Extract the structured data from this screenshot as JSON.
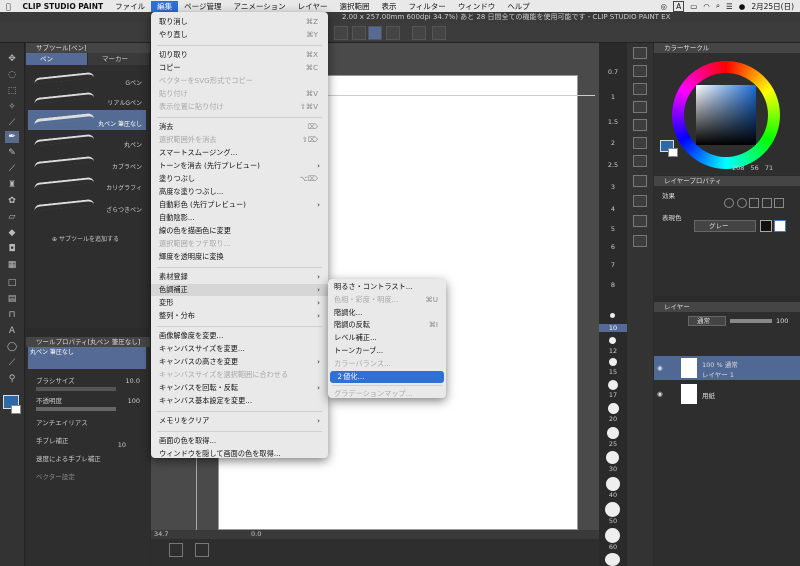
{
  "menubar": {
    "app_name": "CLIP STUDIO PAINT",
    "items": [
      "ファイル",
      "編集",
      "ページ管理",
      "アニメーション",
      "レイヤー",
      "選択範囲",
      "表示",
      "フィルター",
      "ウィンドウ",
      "ヘルプ"
    ],
    "active_item": "編集",
    "status_a": "A",
    "date": "2月25日(日)"
  },
  "titlebar": {
    "text": "2.00 x 257.00mm 600dpi 34.7%) あと 28 日間全ての機能を使用可能です - CLIP STUDIO PAINT EX"
  },
  "subtool_panel": {
    "title": "サブツール[ペン]",
    "tabs": [
      "ペン",
      "マーカー"
    ],
    "brushes": [
      {
        "label": "Gペン",
        "selected": false
      },
      {
        "label": "リアルGペン",
        "selected": false
      },
      {
        "label": "丸ペン 筆圧なし",
        "selected": true
      },
      {
        "label": "丸ペン",
        "selected": false
      },
      {
        "label": "カブラペン",
        "selected": false
      },
      {
        "label": "カリグラフィ",
        "selected": false
      },
      {
        "label": "ざらつきペン",
        "selected": false
      }
    ],
    "add_label": "サブツールを追加する"
  },
  "tool_property": {
    "title": "ツールプロパティ[丸ペン 筆圧なし]",
    "preview_label": "丸ペン 筆圧なし",
    "brush_size_label": "ブラシサイズ",
    "brush_size_value": "10.0",
    "opacity_label": "不透明度",
    "opacity_value": "100",
    "antialias_label": "アンチエイリアス",
    "stabilization_label": "手ブレ補正",
    "stabilization_value": "10",
    "speed_label": "速度による手ブレ補正",
    "vector_label": "ベクター設定"
  },
  "canvas": {
    "zoom_value": "34.7",
    "angle_value": "0.0"
  },
  "zoom_strip": {
    "labels": [
      "0.7",
      "1",
      "1.5",
      "2",
      "2.5",
      "3",
      "4",
      "5",
      "6",
      "7",
      "8",
      "10",
      "12",
      "15",
      "17",
      "20",
      "25",
      "30",
      "40",
      "50",
      "60"
    ],
    "selected": "10"
  },
  "color_panel": {
    "title": "カラーサークル",
    "h": "208",
    "s": "56",
    "v": "71",
    "main_color": "#2f68a8"
  },
  "layer_property": {
    "title": "レイヤープロパティ",
    "effect_label": "効果",
    "display_color_label": "表現色",
    "display_color_value": "グレー"
  },
  "layer_panel": {
    "title": "レイヤー",
    "blend_mode": "通常",
    "opacity": "100",
    "layers": [
      {
        "meta": "100 % 通常",
        "name": "レイヤー 1",
        "selected": true
      },
      {
        "meta": "",
        "name": "用紙",
        "selected": false
      }
    ]
  },
  "edit_menu": {
    "items": [
      {
        "label": "取り消し",
        "shortcut": "⌘Z",
        "disabled": false,
        "submenu": false
      },
      {
        "label": "やり直し",
        "shortcut": "⌘Y",
        "disabled": false,
        "submenu": false
      },
      {
        "sep": true
      },
      {
        "label": "切り取り",
        "shortcut": "⌘X",
        "disabled": false,
        "submenu": false
      },
      {
        "label": "コピー",
        "shortcut": "⌘C",
        "disabled": false,
        "submenu": false
      },
      {
        "label": "ベクターをSVG形式でコピー",
        "shortcut": "",
        "disabled": true,
        "submenu": false
      },
      {
        "label": "貼り付け",
        "shortcut": "⌘V",
        "disabled": true,
        "submenu": false
      },
      {
        "label": "表示位置に貼り付け",
        "shortcut": "⇧⌘V",
        "disabled": true,
        "submenu": false
      },
      {
        "sep": true
      },
      {
        "label": "消去",
        "shortcut": "⌦",
        "disabled": false,
        "submenu": false
      },
      {
        "label": "選択範囲外を消去",
        "shortcut": "⇧⌦",
        "disabled": true,
        "submenu": false
      },
      {
        "label": "スマートスムージング...",
        "shortcut": "",
        "disabled": false,
        "submenu": false
      },
      {
        "label": "トーンを消去 (先行プレビュー)",
        "shortcut": "",
        "disabled": false,
        "submenu": true
      },
      {
        "label": "塗りつぶし",
        "shortcut": "⌥⌦",
        "disabled": false,
        "submenu": false
      },
      {
        "label": "高度な塗りつぶし...",
        "shortcut": "",
        "disabled": false,
        "submenu": false
      },
      {
        "label": "自動彩色 (先行プレビュー)",
        "shortcut": "",
        "disabled": false,
        "submenu": true
      },
      {
        "label": "自動陰影...",
        "shortcut": "",
        "disabled": false,
        "submenu": false
      },
      {
        "label": "線の色を描画色に変更",
        "shortcut": "",
        "disabled": false,
        "submenu": false
      },
      {
        "label": "選択範囲をフチ取り...",
        "shortcut": "",
        "disabled": true,
        "submenu": false
      },
      {
        "label": "輝度を透明度に変換",
        "shortcut": "",
        "disabled": false,
        "submenu": false
      },
      {
        "sep": true
      },
      {
        "label": "素材登録",
        "shortcut": "",
        "disabled": false,
        "submenu": true
      },
      {
        "label": "色調補正",
        "shortcut": "",
        "disabled": false,
        "submenu": true,
        "highlight": true
      },
      {
        "label": "変形",
        "shortcut": "",
        "disabled": false,
        "submenu": true
      },
      {
        "label": "整列・分布",
        "shortcut": "",
        "disabled": false,
        "submenu": true
      },
      {
        "sep": true
      },
      {
        "label": "画像解像度を変更...",
        "shortcut": "",
        "disabled": false,
        "submenu": false
      },
      {
        "label": "キャンバスサイズを変更...",
        "shortcut": "",
        "disabled": false,
        "submenu": false
      },
      {
        "label": "キャンバスの高さを変更",
        "shortcut": "",
        "disabled": false,
        "submenu": true
      },
      {
        "label": "キャンバスサイズを選択範囲に合わせる",
        "shortcut": "",
        "disabled": true,
        "submenu": false
      },
      {
        "label": "キャンバスを回転・反転",
        "shortcut": "",
        "disabled": false,
        "submenu": true
      },
      {
        "label": "キャンバス基本設定を変更...",
        "shortcut": "",
        "disabled": false,
        "submenu": false
      },
      {
        "sep": true
      },
      {
        "label": "メモリをクリア",
        "shortcut": "",
        "disabled": false,
        "submenu": true
      },
      {
        "sep": true
      },
      {
        "label": "画面の色を取得...",
        "shortcut": "",
        "disabled": false,
        "submenu": false
      },
      {
        "label": "ウィンドウを隠して画面の色を取得...",
        "shortcut": "",
        "disabled": false,
        "submenu": false
      }
    ]
  },
  "color_adjust_submenu": {
    "items": [
      {
        "label": "明るさ・コントラスト...",
        "shortcut": "",
        "disabled": false
      },
      {
        "label": "色相・彩度・明度...",
        "shortcut": "⌘U",
        "disabled": true
      },
      {
        "label": "階調化...",
        "shortcut": "",
        "disabled": false
      },
      {
        "label": "階調の反転",
        "shortcut": "⌘I",
        "disabled": false
      },
      {
        "label": "レベル補正...",
        "shortcut": "",
        "disabled": false
      },
      {
        "label": "トーンカーブ...",
        "shortcut": "",
        "disabled": false
      },
      {
        "label": "カラーバランス...",
        "shortcut": "",
        "disabled": true
      },
      {
        "label": "２値化...",
        "shortcut": "",
        "disabled": false,
        "highlight": true
      },
      {
        "sep": true
      },
      {
        "label": "グラデーションマップ...",
        "shortcut": "",
        "disabled": true
      }
    ]
  }
}
